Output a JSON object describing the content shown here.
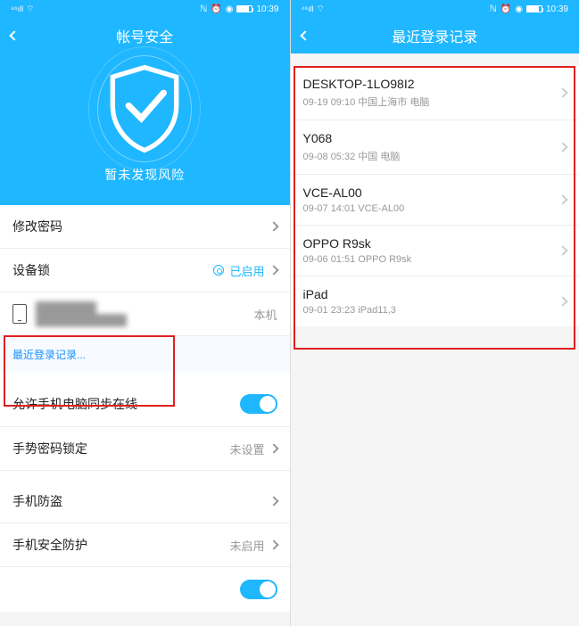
{
  "status": {
    "time": "10:39"
  },
  "left": {
    "title": "帐号安全",
    "hero_text": "暂未发现风险",
    "rows": {
      "change_pwd": "修改密码",
      "device_lock": "设备锁",
      "device_lock_status": "已启用",
      "this_device": "本机",
      "recent_login_link": "最近登录记录...",
      "sync_online": "允许手机电脑同步在线",
      "gesture_lock": "手势密码锁定",
      "gesture_status": "未设置",
      "phone_antitheft": "手机防盗",
      "phone_security": "手机安全防护",
      "phone_security_status": "未启用"
    }
  },
  "right": {
    "title": "最近登录记录",
    "logins": [
      {
        "name": "DESKTOP-1LO98I2",
        "meta": "09-19  09:10 中国上海市 电脑"
      },
      {
        "name": "Y068",
        "meta": "09-08  05:32 中国 电脑"
      },
      {
        "name": "VCE-AL00",
        "meta": "09-07  14:01 VCE-AL00"
      },
      {
        "name": "OPPO R9sk",
        "meta": "09-06  01:51 OPPO R9sk"
      },
      {
        "name": "iPad",
        "meta": "09-01  23:23 iPad11,3"
      }
    ]
  }
}
